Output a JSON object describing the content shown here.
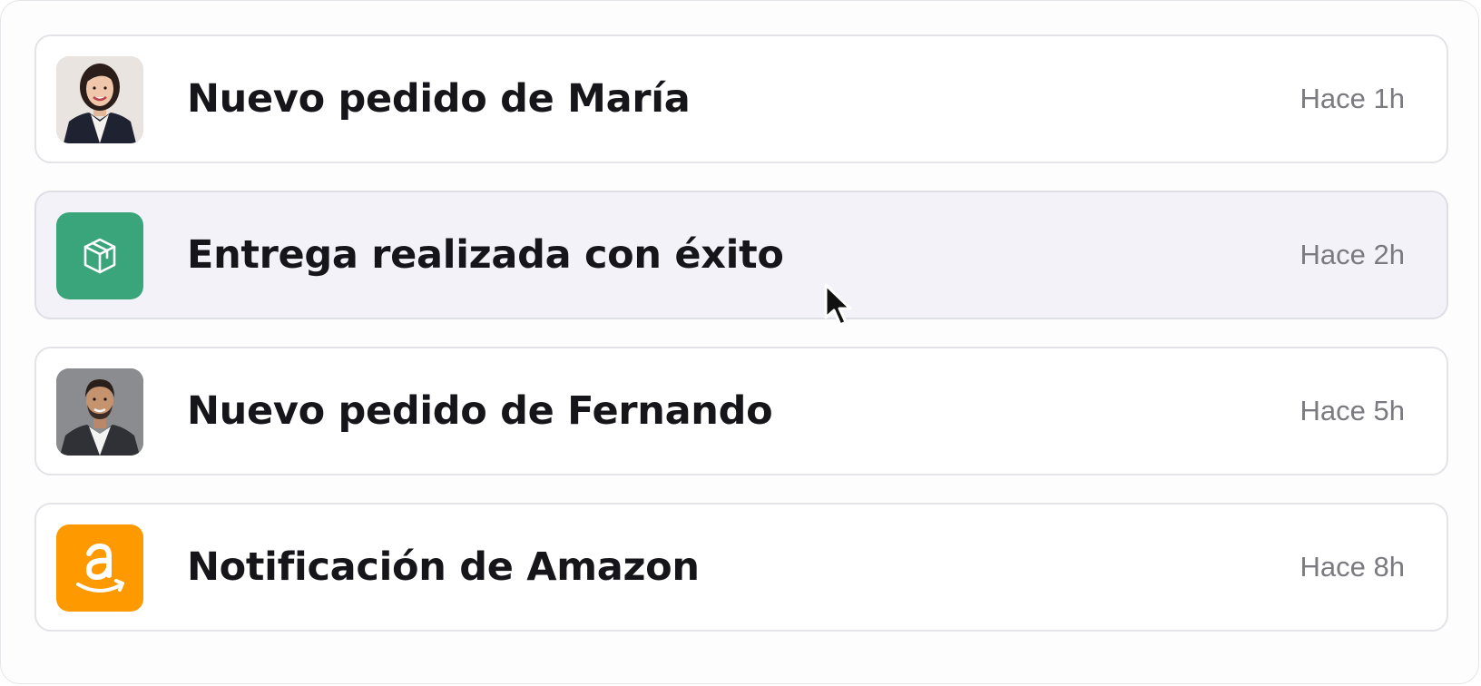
{
  "notifications": [
    {
      "title": "Nuevo pedido de María",
      "time": "Hace 1h",
      "icon": "avatar-maria",
      "state": "normal"
    },
    {
      "title": "Entrega realizada con éxito",
      "time": "Hace 2h",
      "icon": "package-icon",
      "icon_color": "#3aa57b",
      "state": "hover"
    },
    {
      "title": "Nuevo pedido de Fernando",
      "time": "Hace 5h",
      "icon": "avatar-fernando",
      "state": "normal"
    },
    {
      "title": "Notificación de Amazon",
      "time": "Hace 8h",
      "icon": "amazon-icon",
      "icon_color": "#ff9900",
      "state": "normal"
    }
  ]
}
